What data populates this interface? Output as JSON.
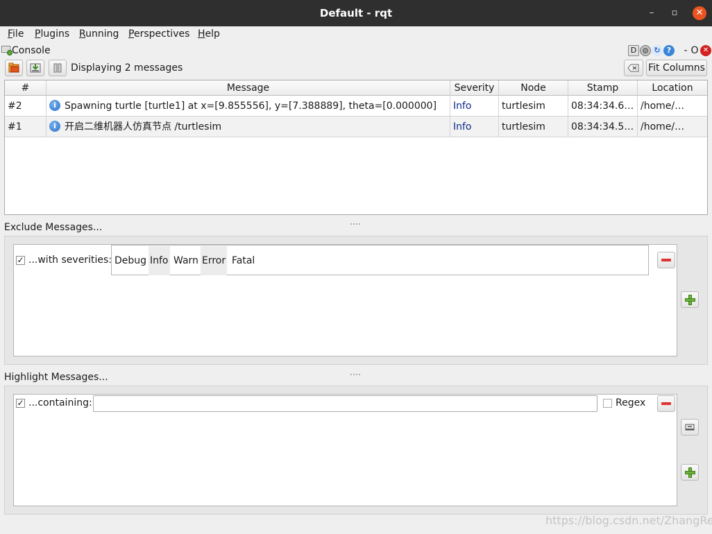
{
  "window": {
    "title": "Default - rqt"
  },
  "menubar": {
    "items": [
      {
        "accel": "F",
        "rest": "ile"
      },
      {
        "accel": "P",
        "rest": "lugins"
      },
      {
        "accel": "R",
        "rest": "unning"
      },
      {
        "accel": "P",
        "rest": "erspectives"
      },
      {
        "accel": "H",
        "rest": "elp"
      }
    ]
  },
  "plugin": {
    "title": "Console",
    "header_icons": [
      "D",
      "gear-icon",
      "reload-icon",
      "help-icon"
    ],
    "header_min": "-",
    "header_float": "O"
  },
  "toolbar": {
    "status": "Displaying 2 messages",
    "fit_columns_label": "Fit Columns"
  },
  "table": {
    "columns": [
      "#",
      "Message",
      "Severity",
      "Node",
      "Stamp",
      "Location"
    ],
    "rows": [
      {
        "num": "#2",
        "message": "Spawning turtle [turtle1] at x=[9.855556], y=[7.388889], theta=[0.000000]",
        "severity": "Info",
        "node": "turtlesim",
        "stamp": "08:34:34.6…",
        "location": "/home/…"
      },
      {
        "num": "#1",
        "message": "开启二维机器人仿真节点 /turtlesim",
        "severity": "Info",
        "node": "turtlesim",
        "stamp": "08:34:34.5…",
        "location": "/home/…"
      }
    ]
  },
  "exclude": {
    "label": "Exclude Messages...",
    "filter_label": "...with severities:",
    "checked": true,
    "severities": [
      "Debug",
      "Info",
      "Warn",
      "Error",
      "Fatal"
    ]
  },
  "highlight": {
    "label": "Highlight Messages...",
    "filter_label": "...containing:",
    "checked": true,
    "input_value": "",
    "regex_label": "Regex",
    "regex_checked": false
  },
  "watermark": "https://blog.csdn.net/ZhangRelay",
  "colors": {
    "titlebar": "#2f2f2f",
    "close": "#e95420",
    "info_text": "#0c2a8a"
  }
}
